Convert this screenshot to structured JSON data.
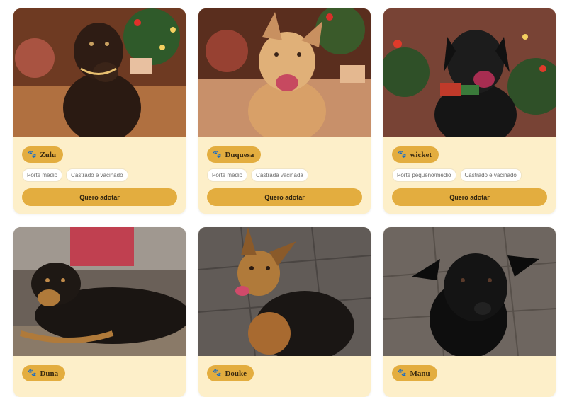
{
  "dogs": [
    {
      "name": "Zulu",
      "tags": [
        "Porte médio",
        "Castrado e vacinado"
      ],
      "button": "Quero adotar",
      "photo": "black dog with gold collar in Christmas setting"
    },
    {
      "name": "Duquesa",
      "tags": [
        "Porte medio",
        "Castrada vacinada"
      ],
      "button": "Quero adotar",
      "photo": "tan dog smiling in Christmas setting"
    },
    {
      "name": "wicket",
      "tags": [
        "Porte pequeno/medio",
        "Castrado e vacinado"
      ],
      "button": "Quero adotar",
      "photo": "black dog with plaid bow tie in Christmas setting"
    },
    {
      "name": "Duna",
      "photo": "black and tan dog lying down"
    },
    {
      "name": "Douke",
      "photo": "black and tan dog sitting on stone floor"
    },
    {
      "name": "Manu",
      "photo": "black dog standing on stone floor"
    }
  ],
  "colors": {
    "card_bg": "#fdefc9",
    "accent": "#e3ad3f"
  },
  "icons": {
    "name_icon": "paw-icon"
  }
}
